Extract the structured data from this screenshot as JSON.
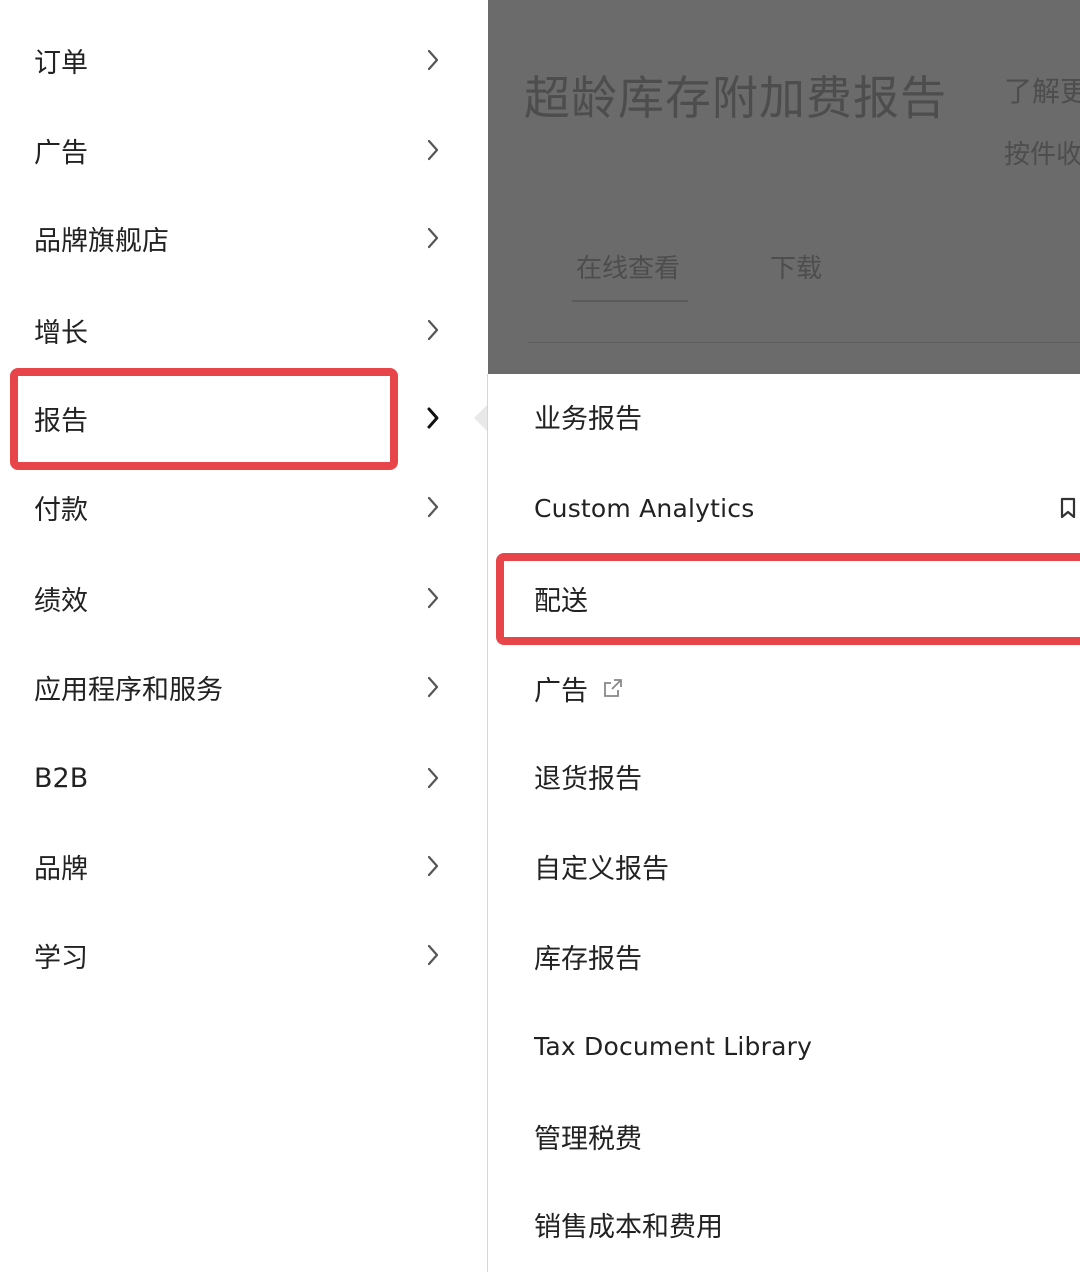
{
  "background_page": {
    "title": "超龄库存附加费报告",
    "side_text_1": "了解更",
    "side_text_2": "按件收",
    "tabs": [
      {
        "label": "在线查看"
      },
      {
        "label": "下载"
      }
    ]
  },
  "main_menu": {
    "items": [
      {
        "label": "订单"
      },
      {
        "label": "广告"
      },
      {
        "label": "品牌旗舰店"
      },
      {
        "label": "增长"
      },
      {
        "label": "报告",
        "selected": true
      },
      {
        "label": "付款"
      },
      {
        "label": "绩效"
      },
      {
        "label": "应用程序和服务"
      },
      {
        "label": "B2B"
      },
      {
        "label": "品牌"
      },
      {
        "label": "学习"
      }
    ]
  },
  "sub_menu": {
    "items": [
      {
        "label": "业务报告"
      },
      {
        "label": "Custom Analytics",
        "icon": "bookmark-icon"
      },
      {
        "label": "配送",
        "highlighted": true
      },
      {
        "label": "广告",
        "icon": "external-link-icon"
      },
      {
        "label": "退货报告"
      },
      {
        "label": "自定义报告"
      },
      {
        "label": "库存报告"
      },
      {
        "label": "Tax Document Library"
      },
      {
        "label": "管理税费"
      },
      {
        "label": "销售成本和费用"
      }
    ]
  },
  "colors": {
    "highlight_border": "#e8454b",
    "overlay_dim": "#6b6b6b",
    "text_primary": "#222222"
  }
}
